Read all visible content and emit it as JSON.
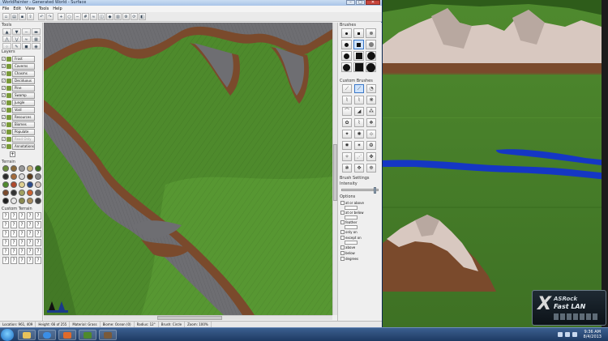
{
  "window": {
    "title": "WorldPainter - Generated World - Surface",
    "controls": [
      "–",
      "□",
      "✕"
    ]
  },
  "menu": [
    "File",
    "Edit",
    "View",
    "Tools",
    "Help"
  ],
  "panels": {
    "tools_header": "Tools",
    "layers_header": "Layers",
    "terrain_header": "Terrain",
    "custom_terrain_header": "Custom Terrain",
    "brushes_header": "Brushes",
    "custom_brushes_header": "Custom Brushes",
    "brush_settings_header": "Brush Settings",
    "intensity_label": "Intensity",
    "options_header": "Options"
  },
  "layers": [
    {
      "label": "Frost",
      "enabled": true
    },
    {
      "label": "Caverns",
      "enabled": true
    },
    {
      "label": "Chasms",
      "enabled": true
    },
    {
      "label": "Deciduous",
      "enabled": true
    },
    {
      "label": "Pine",
      "enabled": true
    },
    {
      "label": "Swamp",
      "enabled": true
    },
    {
      "label": "Jungle",
      "enabled": true
    },
    {
      "label": "Void",
      "enabled": true
    },
    {
      "label": "Resources",
      "enabled": true
    },
    {
      "label": "Biomes",
      "enabled": true
    },
    {
      "label": "Populate",
      "enabled": true
    },
    {
      "label": "Read Only",
      "enabled": false
    },
    {
      "label": "Annotations",
      "enabled": true
    }
  ],
  "options": [
    {
      "label": "at or above",
      "value": ""
    },
    {
      "label": "at or below",
      "value": ""
    },
    {
      "label": "feather",
      "value": ""
    },
    {
      "label": "only on",
      "value": ""
    },
    {
      "label": "except on",
      "value": ""
    },
    {
      "label": "above",
      "value": ""
    },
    {
      "label": "below",
      "value": ""
    },
    {
      "label": "degrees",
      "value": ""
    }
  ],
  "status": {
    "location": "Location: 961, 409",
    "height": "Height: 66 of 255",
    "material": "Material: Grass",
    "biome": "Biome: Ocean (0)",
    "radius": "Radius: 12°",
    "brush": "Brush: Circle",
    "zoom": "Zoom: 100%"
  },
  "taskbar": {
    "time": "9:36 AM",
    "date": "8/4/2013"
  },
  "overlay_badge": {
    "brand": "ASRock",
    "product": "Fast LAN",
    "letter": "X"
  },
  "colors": {
    "grass": "#4e8a2c",
    "grass_dark": "#3b6e20",
    "rock": "#6e6e72",
    "dirt": "#7a4a2c",
    "water": "#1537c4",
    "snow": "#d8c8c0"
  }
}
